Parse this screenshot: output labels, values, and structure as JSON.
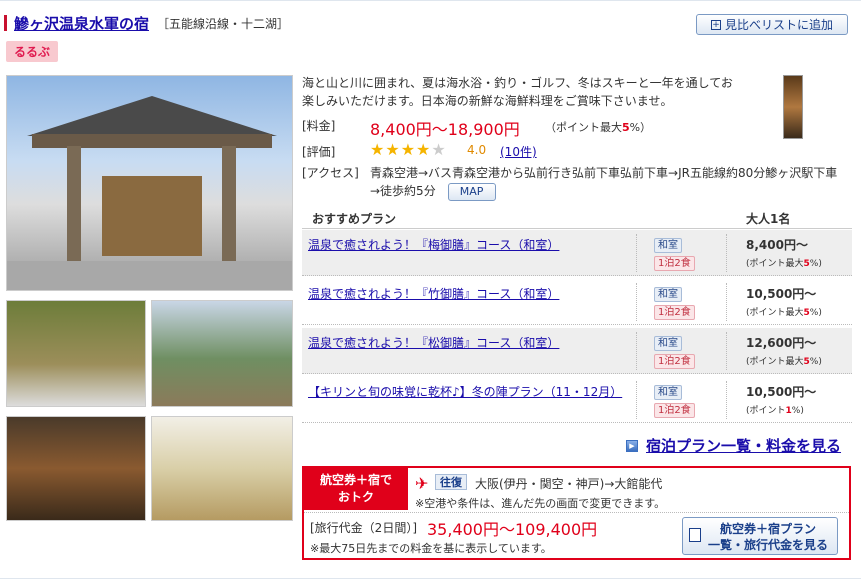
{
  "hotel": {
    "name": "鰺ヶ沢温泉水軍の宿",
    "line": "［五能線沿線・十二湖］",
    "compare_label": "見比べリストに追加",
    "brand_badge": "るるぶ",
    "description": "海と山と川に囲まれ、夏は海水浴・釣り・ゴルフ、冬はスキーと一年を通してお楽しみいただけます。日本海の新鮮な海鮮料理をご賞味下さいませ。",
    "price_label": "[料金]",
    "price": "8,400円〜18,900円",
    "points_prefix": "（ポイント最大",
    "points_value": "5",
    "points_suffix": "%）",
    "rating_label": "[評価]",
    "rating_value": "4.0",
    "rating_stars": 4.0,
    "review_count": "(10件)",
    "access_label": "[アクセス]",
    "access_text": "青森空港→バス青森空港から弘前行き弘前下車弘前下車→JR五能線約80分鯵ヶ沢駅下車→徒歩約5分",
    "map_label": "MAP"
  },
  "plans": {
    "header_plan": "おすすめプラン",
    "header_price": "大人1名",
    "items": [
      {
        "name": "温泉で癒されよう！『梅御膳』コース（和室）",
        "room": "和室",
        "meals": "1泊2食",
        "price": "8,400円〜",
        "pts_prefix": "(ポイント最大",
        "pts_value": "5",
        "pts_suffix": "%)"
      },
      {
        "name": "温泉で癒されよう！『竹御膳』コース（和室）",
        "room": "和室",
        "meals": "1泊2食",
        "price": "10,500円〜",
        "pts_prefix": "(ポイント最大",
        "pts_value": "5",
        "pts_suffix": "%)"
      },
      {
        "name": "温泉で癒されよう！『松御膳』コース（和室）",
        "room": "和室",
        "meals": "1泊2食",
        "price": "12,600円〜",
        "pts_prefix": "(ポイント最大",
        "pts_value": "5",
        "pts_suffix": "%)"
      },
      {
        "name": "【キリンと旬の味覚に乾杯♪】冬の陣プラン（11・12月）",
        "room": "和室",
        "meals": "1泊2食",
        "price": "10,500円〜",
        "pts_prefix": "(ポイント",
        "pts_value": "1",
        "pts_suffix": "%)"
      }
    ],
    "all_link": "宿泊プラン一覧・料金を見る"
  },
  "air": {
    "tag_line1": "航空券＋宿で",
    "tag_line2": "おトク",
    "roundtrip": "往復",
    "route": "大阪(伊丹・関空・神戸)→大館能代",
    "note1": "※空港や条件は、進んだ先の画面で変更できます。",
    "fare_label": "[旅行代金（2日間）]",
    "fare": "35,400円〜109,400円",
    "note2": "※最大75日先までの料金を基に表示しています。",
    "button_line1": "航空券＋宿プラン",
    "button_line2": "一覧・旅行代金を見る"
  },
  "colors": {
    "accent_red": "#e0001a",
    "link_blue": "#1a0dab",
    "star": "#f5b400"
  }
}
